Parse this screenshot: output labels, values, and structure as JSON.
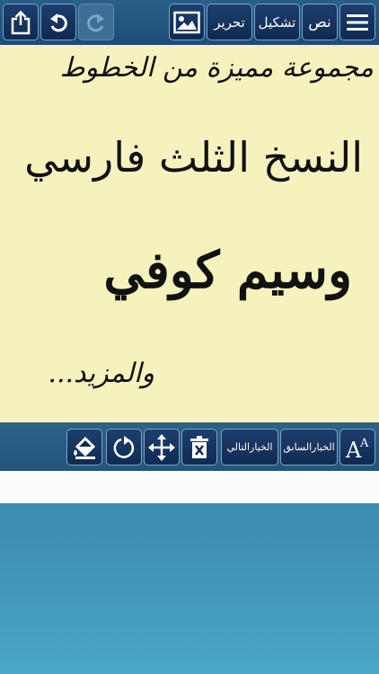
{
  "toolbar": {
    "menu_icon": "hamburger-icon",
    "text_label": "نص",
    "diacritics_label": "تشكيل",
    "edit_label": "تحرير",
    "image_icon": "image-icon",
    "redo_icon": "redo-icon",
    "undo_icon": "undo-icon",
    "share_icon": "share-icon"
  },
  "canvas": {
    "line1": "مجموعة مميزة من الخطوط",
    "line2": "النسخ الثلث فارسي",
    "line3": "وسيم كوفي",
    "line4": "والمزيد..."
  },
  "edit_bar": {
    "font_size_icon": "font-size-icon",
    "prev_option_label": "الخيارالسابق",
    "next_option_label": "الخيارالتالي",
    "delete_icon": "delete-icon",
    "move_icon": "move-icon",
    "rotate_icon": "rotate-icon",
    "fill_icon": "paint-bucket-icon"
  },
  "colors": {
    "canvas_bg": "#f6f2bd",
    "button_bg": "#0f2a52",
    "button_border": "#7aa3c8"
  }
}
